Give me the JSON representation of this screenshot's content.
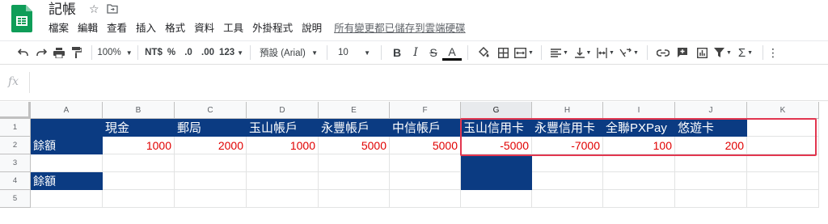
{
  "doc": {
    "title": "記帳",
    "save_status": "所有變更都已儲存到雲端硬碟"
  },
  "menu": [
    "檔案",
    "編輯",
    "查看",
    "插入",
    "格式",
    "資料",
    "工具",
    "外掛程式",
    "說明"
  ],
  "toolbar": {
    "zoom": "100%",
    "currency": "NT$",
    "percent": "%",
    "dec_less": ".0",
    "dec_more": ".00",
    "more_formats": "123",
    "font": "預設 (Arial)",
    "font_size": "10",
    "bold": "B",
    "italic": "I",
    "strike": "S",
    "text_color": "A",
    "sum": "Σ"
  },
  "columns": [
    "A",
    "B",
    "C",
    "D",
    "E",
    "F",
    "G",
    "H",
    "I",
    "J",
    "K"
  ],
  "rows": [
    "1",
    "2",
    "3",
    "4",
    "5"
  ],
  "cells": {
    "B1": "現金",
    "C1": "郵局",
    "D1": "玉山帳戶",
    "E1": "永豐帳戶",
    "F1": "中信帳戶",
    "G1": "玉山信用卡",
    "H1": "永豐信用卡",
    "I1": "全聯PXPay",
    "J1": "悠遊卡",
    "A2": "餘額",
    "B2": "1000",
    "C2": "2000",
    "D2": "1000",
    "E2": "5000",
    "F2": "5000",
    "G2": "-5000",
    "H2": "-7000",
    "I2": "100",
    "J2": "200",
    "A4": "餘額"
  },
  "colors": {
    "header_fill": "#0b3b82",
    "value_text": "#e00000",
    "highlight_border": "#e2364f"
  },
  "selected_column": "G"
}
